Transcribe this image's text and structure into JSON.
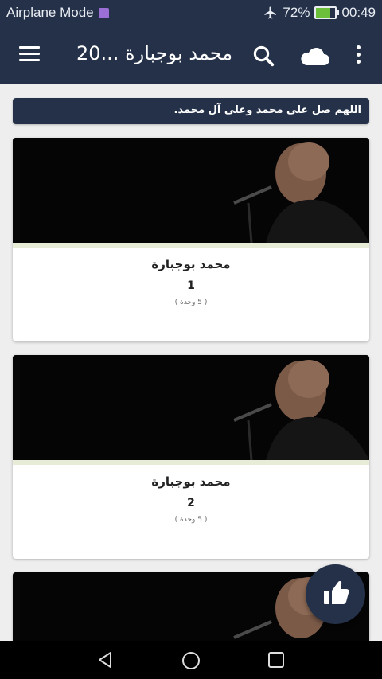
{
  "status_bar": {
    "airplane_mode": "Airplane Mode",
    "battery_percent": "72%",
    "time": "00:49",
    "battery_level": 0.72,
    "icons": [
      "message-icon",
      "airplane-icon",
      "battery-icon"
    ]
  },
  "app_bar": {
    "title": "محمد بوجبارة ...20",
    "icons": [
      "menu-icon",
      "search-icon",
      "cloud-icon",
      "more-vert-icon"
    ]
  },
  "banner": {
    "text": "اللهم صل على محمد وعلى آل محمد."
  },
  "cards": [
    {
      "title": "محمد بوجبارة",
      "number": "1",
      "count": "( 5 وحدة )"
    },
    {
      "title": "محمد بوجبارة",
      "number": "2",
      "count": "( 5 وحدة )"
    },
    {
      "title": "",
      "number": "",
      "count": ""
    }
  ],
  "fab": {
    "icon": "thumbs-up-icon"
  },
  "nav_bar": {
    "icons": [
      "back-icon",
      "home-icon",
      "recent-apps-icon"
    ]
  },
  "colors": {
    "primary": "#243149",
    "background": "#eeeeee",
    "card": "#ffffff",
    "stripe": "#e6ecd6",
    "battery": "#6bbf3a"
  }
}
